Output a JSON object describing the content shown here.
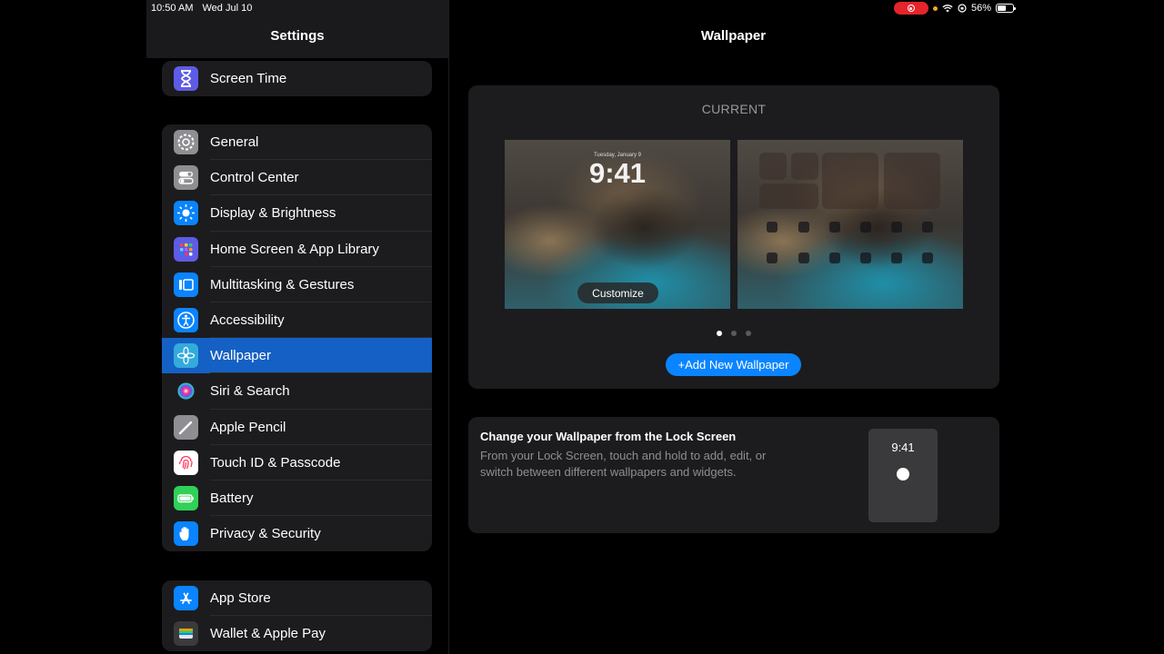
{
  "status_bar": {
    "time": "10:50 AM",
    "date": "Wed Jul 10",
    "battery": "56%",
    "battery_level": 0.56
  },
  "sidebar": {
    "title": "Settings",
    "groups": [
      {
        "items": [
          {
            "label": "Screen Time",
            "icon": "hourglass-icon",
            "color": "#5e5ce6"
          }
        ]
      },
      {
        "items": [
          {
            "label": "General",
            "icon": "gear-icon",
            "color": "#8e8e93"
          },
          {
            "label": "Control Center",
            "icon": "toggles-icon",
            "color": "#8e8e93"
          },
          {
            "label": "Display & Brightness",
            "icon": "sun-icon",
            "color": "#0a84ff"
          },
          {
            "label": "Home Screen & App Library",
            "icon": "app-grid-icon",
            "color": "#5e5ce6"
          },
          {
            "label": "Multitasking & Gestures",
            "icon": "multitasking-icon",
            "color": "#0a84ff"
          },
          {
            "label": "Accessibility",
            "icon": "accessibility-icon",
            "color": "#0a84ff"
          },
          {
            "label": "Wallpaper",
            "icon": "flower-icon",
            "color": "#34aadc",
            "selected": true
          },
          {
            "label": "Siri & Search",
            "icon": "siri-icon",
            "color": "#1c1c1e"
          },
          {
            "label": "Apple Pencil",
            "icon": "pencil-icon",
            "color": "#8e8e93"
          },
          {
            "label": "Touch ID & Passcode",
            "icon": "fingerprint-icon",
            "color": "#ffffff"
          },
          {
            "label": "Battery",
            "icon": "battery-icon",
            "color": "#30d158"
          },
          {
            "label": "Privacy & Security",
            "icon": "hand-icon",
            "color": "#0a84ff"
          }
        ]
      },
      {
        "items": [
          {
            "label": "App Store",
            "icon": "app-store-icon",
            "color": "#0a84ff"
          },
          {
            "label": "Wallet & Apple Pay",
            "icon": "wallet-icon",
            "color": "#3a3a3c"
          }
        ]
      }
    ]
  },
  "detail": {
    "title": "Wallpaper",
    "current_label": "CURRENT",
    "lock_screen": {
      "date": "Tuesday, January 9",
      "time": "9:41",
      "customize_label": "Customize"
    },
    "page_count": 3,
    "active_page": 0,
    "add_button_label": "+Add New Wallpaper",
    "tip": {
      "title": "Change your Wallpaper from the Lock Screen",
      "body": "From your Lock Screen, touch and hold to add, edit, or switch between different wallpapers and widgets.",
      "preview_time": "9:41"
    }
  },
  "colors": {
    "accent": "#0a84ff",
    "selected_row": "#1560c4",
    "recording": "#e5242b"
  }
}
